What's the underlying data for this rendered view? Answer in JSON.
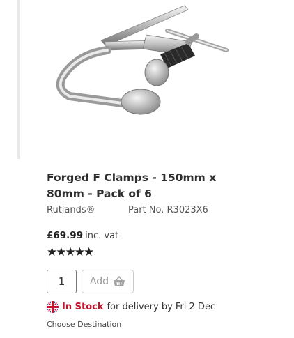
{
  "product": {
    "title": "Forged F Clamps - 150mm x 80mm - Pack of 6",
    "brand": "Rutlands®",
    "part_no": "Part No. R3023X6",
    "price": "£69.99",
    "price_suffix": "inc. vat",
    "rating_stars": "★★★★★",
    "rating_value": 5,
    "image_icon": "f-clamp-product-image"
  },
  "cart": {
    "quantity": "1",
    "add_label": "Add",
    "basket_icon": "basket-icon"
  },
  "availability": {
    "flag_icon": "uk-flag-icon",
    "status": "In Stock",
    "delivery_text": "for delivery by Fri 2 Dec",
    "destination_link": "Choose Destination"
  },
  "colors": {
    "in_stock": "#c8102e",
    "text": "#333333",
    "button_border": "#c9c9c9"
  }
}
